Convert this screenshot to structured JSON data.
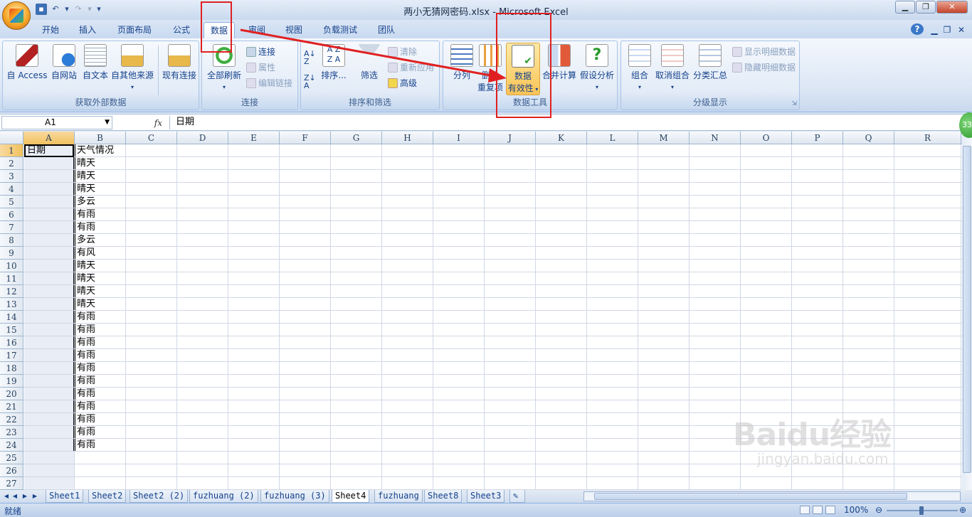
{
  "window": {
    "title": "两小无猜网密码.xlsx - Microsoft Excel"
  },
  "tabs": [
    "开始",
    "插入",
    "页面布局",
    "公式",
    "数据",
    "审阅",
    "视图",
    "负载测试",
    "团队"
  ],
  "active_tab": "数据",
  "ribbon": {
    "external": {
      "label": "获取外部数据",
      "buttons": [
        "自 Access",
        "自网站",
        "自文本",
        "自其他来源",
        "现有连接"
      ]
    },
    "connections": {
      "label": "连接",
      "refresh": "全部刷新",
      "small": [
        "连接",
        "属性",
        "编辑链接"
      ]
    },
    "sort": {
      "label": "排序和筛选",
      "sort": "排序...",
      "filter": "筛选",
      "small": [
        "清除",
        "重新应用",
        "高级"
      ]
    },
    "tools": {
      "label": "数据工具",
      "split": "分列",
      "dup_top": "删除",
      "dup_bottom": "重复项",
      "validation_top": "数据",
      "validation_bottom": "有效性",
      "consolidate": "合并计算",
      "whatif": "假设分析"
    },
    "outline": {
      "label": "分级显示",
      "buttons": [
        "组合",
        "取消组合",
        "分类汇总"
      ],
      "small": [
        "显示明细数据",
        "隐藏明细数据"
      ]
    }
  },
  "formula_bar": {
    "name_box": "A1",
    "fx": "fx",
    "value": "日期"
  },
  "columns": [
    "A",
    "B",
    "C",
    "D",
    "E",
    "F",
    "G",
    "H",
    "I",
    "J",
    "K",
    "L",
    "M",
    "N",
    "O",
    "P",
    "Q",
    "R"
  ],
  "rows": [
    "1",
    "2",
    "3",
    "4",
    "5",
    "6",
    "7",
    "8",
    "9",
    "10",
    "11",
    "12",
    "13",
    "14",
    "15",
    "16",
    "17",
    "18",
    "19",
    "20",
    "21",
    "22",
    "23",
    "24",
    "25",
    "26",
    "27"
  ],
  "cells": {
    "A1": "日期",
    "B": [
      "天气情况",
      "晴天",
      "晴天",
      "晴天",
      "多云",
      "有雨",
      "有雨",
      "多云",
      "有风",
      "晴天",
      "晴天",
      "晴天",
      "晴天",
      "有雨",
      "有雨",
      "有雨",
      "有雨",
      "有雨",
      "有雨",
      "有雨",
      "有雨",
      "有雨",
      "有雨",
      "有雨"
    ]
  },
  "sheets": [
    "Sheet1",
    "Sheet2",
    "Sheet2 (2)",
    "fuzhuang (2)",
    "fuzhuang (3)",
    "Sheet4",
    "fuzhuang",
    "Sheet8",
    "Sheet3"
  ],
  "active_sheet": "Sheet4",
  "status": {
    "ready": "就绪",
    "zoom": "100%"
  },
  "watermark": {
    "logo": "Baidu经验",
    "sub": "jingyan.baidu.com"
  },
  "badge": "33",
  "colors": {
    "highlight": "#e02020",
    "ribbon_text": "#15428b"
  }
}
